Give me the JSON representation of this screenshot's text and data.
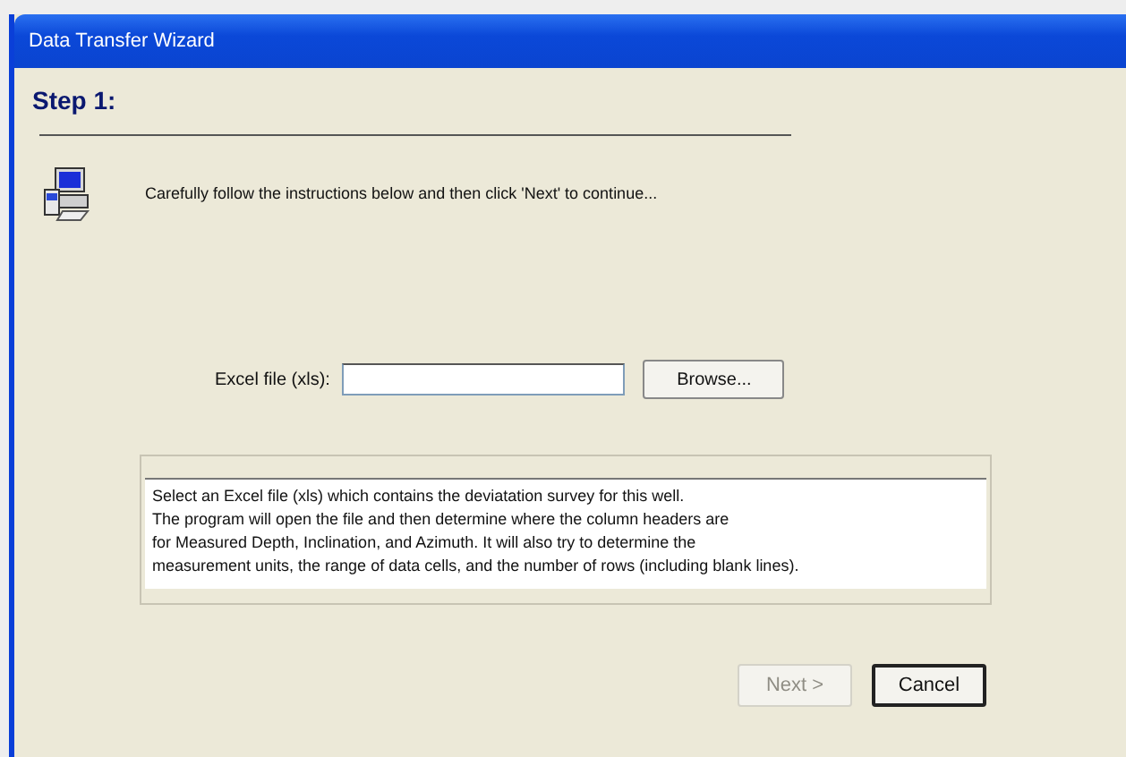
{
  "window": {
    "title": "Data Transfer Wizard"
  },
  "step_title": "Step 1:",
  "instruction": "Carefully follow the instructions below and then click 'Next' to continue...",
  "file_field": {
    "label": "Excel file (xls):"
  },
  "browse_button": "Browse...",
  "description_lines": [
    "Select an Excel file (xls) which contains the deviatation survey for this well.",
    "The program will open the file and then determine where the column headers are",
    "for Measured Depth, Inclination, and Azimuth. It will also try to determine the",
    "measurement units, the range of data cells, and the number of rows (including blank lines)."
  ],
  "buttons": [
    {
      "label": "Next >",
      "disabled": true
    },
    {
      "label": "Cancel",
      "disabled": false
    }
  ]
}
